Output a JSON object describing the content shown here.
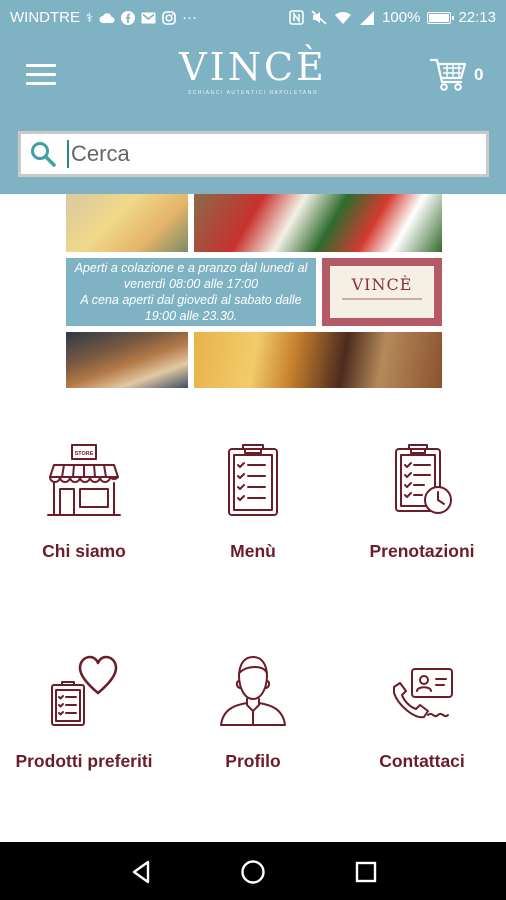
{
  "status_bar": {
    "carrier": "WINDTRE",
    "more": "···",
    "battery": "100%",
    "battery_level": 1.0,
    "time": "22:13",
    "icons": [
      "usb-icon",
      "cloud-icon",
      "facebook-icon",
      "gmail-icon",
      "instagram-icon",
      "nfc-icon",
      "mute-icon",
      "wifi-icon",
      "signal-icon",
      "battery-icon"
    ]
  },
  "header": {
    "brand": "VINCÈ",
    "tagline": "SCHIAGCI AUTENTICI NAPOLETANO",
    "cart_count": "0",
    "menu_icon": "hamburger-icon",
    "cart_icon": "cart-icon"
  },
  "search": {
    "placeholder": "Cerca",
    "value": ""
  },
  "banner": {
    "info_lines": [
      "Aperti a colazione e a pranzo dal lunedì al",
      "venerdì 08:00 alle 17:00",
      "A cena aperti dal giovedì al sabato dalle",
      "19:00 alle 23.30."
    ],
    "logo_text": "VINCÈ"
  },
  "menu_tiles": [
    {
      "id": "chi-siamo",
      "label": "Chi siamo",
      "icon": "store-icon"
    },
    {
      "id": "menu",
      "label": "Menù",
      "icon": "clipboard-checklist-icon"
    },
    {
      "id": "prenotazioni",
      "label": "Prenotazioni",
      "icon": "clipboard-clock-icon"
    },
    {
      "id": "preferiti",
      "label": "Prodotti preferiti",
      "icon": "clipboard-heart-icon"
    },
    {
      "id": "profilo",
      "label": "Profilo",
      "icon": "user-profile-icon"
    },
    {
      "id": "contattaci",
      "label": "Contattaci",
      "icon": "phone-contact-icon"
    }
  ],
  "store_sign": "STORE",
  "colors": {
    "accent": "#7fb3c4",
    "brand_dark": "#6b1d2a",
    "nav_bg": "#000000"
  }
}
